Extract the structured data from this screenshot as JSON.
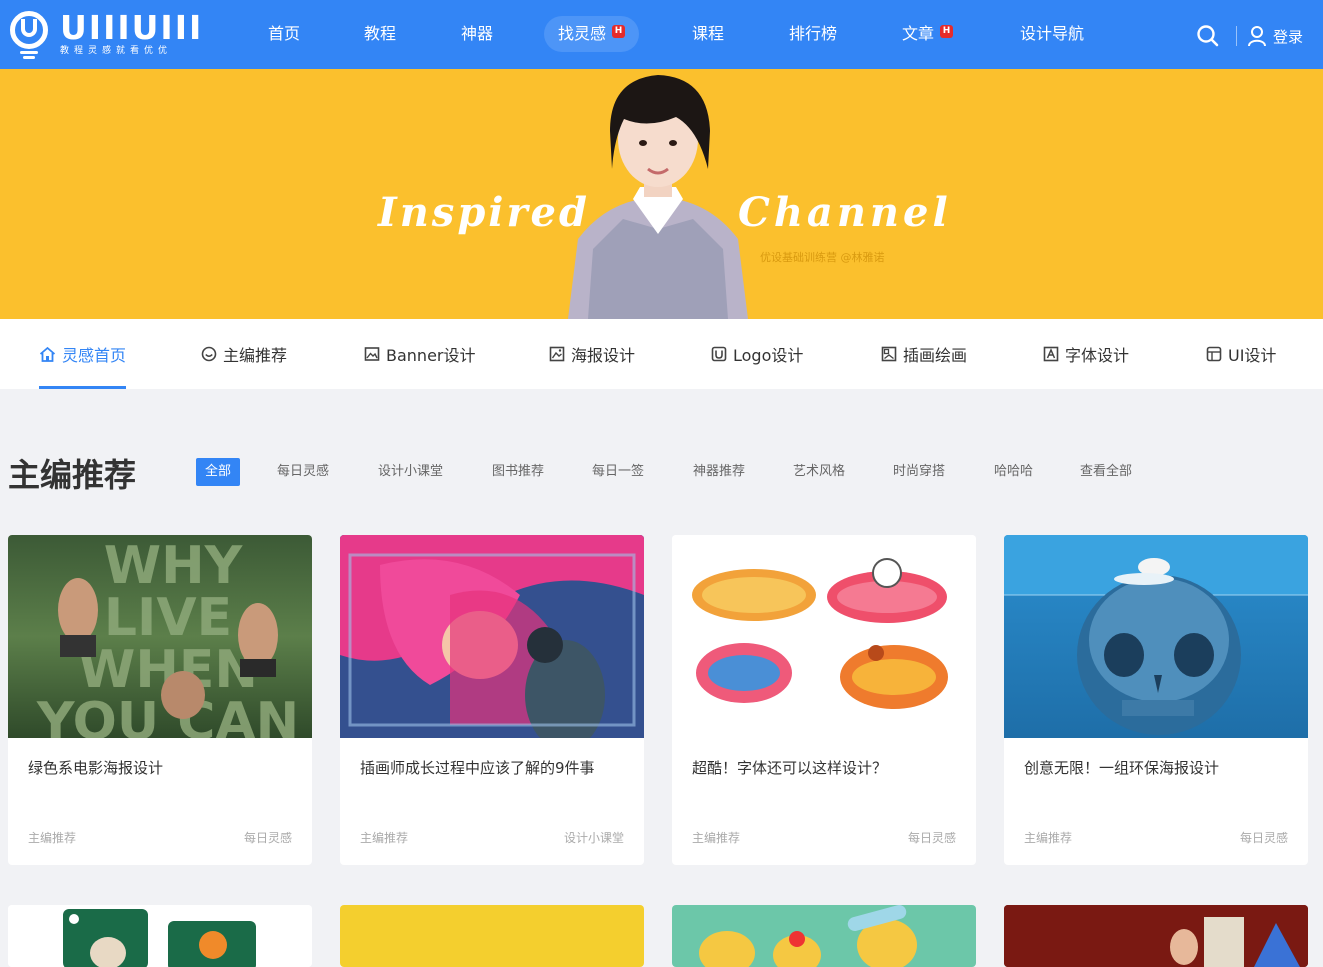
{
  "brand": {
    "name": "UIIIUIII",
    "slogan": "教程灵感就看优优"
  },
  "nav": {
    "items": [
      {
        "label": "首页",
        "hot": false,
        "active": false
      },
      {
        "label": "教程",
        "hot": false,
        "active": false
      },
      {
        "label": "神器",
        "hot": false,
        "active": false
      },
      {
        "label": "找灵感",
        "hot": true,
        "active": true
      },
      {
        "label": "课程",
        "hot": false,
        "active": false
      },
      {
        "label": "排行榜",
        "hot": false,
        "active": false
      },
      {
        "label": "文章",
        "hot": true,
        "active": false
      },
      {
        "label": "设计导航",
        "hot": false,
        "active": false
      }
    ],
    "hot_badge": "H",
    "login_label": "登录"
  },
  "banner": {
    "word_left": "Inspired",
    "word_right": "Channel",
    "credit": "优设基础训练营  @林雅诺"
  },
  "categories": [
    {
      "label": "灵感首页",
      "icon": "home-icon",
      "active": true
    },
    {
      "label": "主编推荐",
      "icon": "smile-icon",
      "active": false
    },
    {
      "label": "Banner设计",
      "icon": "image-icon",
      "active": false
    },
    {
      "label": "海报设计",
      "icon": "poster-icon",
      "active": false
    },
    {
      "label": "Logo设计",
      "icon": "logo-icon",
      "active": false
    },
    {
      "label": "插画绘画",
      "icon": "illustration-icon",
      "active": false
    },
    {
      "label": "字体设计",
      "icon": "font-icon",
      "active": false
    },
    {
      "label": "UI设计",
      "icon": "ui-icon",
      "active": false
    }
  ],
  "section": {
    "title": "主编推荐",
    "filters": [
      "全部",
      "每日灵感",
      "设计小课堂",
      "图书推荐",
      "每日一签",
      "神器推荐",
      "艺术风格",
      "时尚穿搭",
      "哈哈哈",
      "查看全部"
    ]
  },
  "cards": [
    {
      "title": "绿色系电影海报设计",
      "tag_left": "主编推荐",
      "tag_right": "每日灵感",
      "image_text": "WHY LIVE WHEN YOU CAN"
    },
    {
      "title": "插画师成长过程中应该了解的9件事",
      "tag_left": "主编推荐",
      "tag_right": "设计小课堂",
      "image_text": ""
    },
    {
      "title": "超酷！字体还可以这样设计？",
      "tag_left": "主编推荐",
      "tag_right": "每日灵感",
      "image_text": ""
    },
    {
      "title": "创意无限！一组环保海报设计",
      "tag_left": "主编推荐",
      "tag_right": "每日灵感",
      "image_text": ""
    }
  ],
  "colors": {
    "primary": "#3385f5",
    "banner": "#fbc02d",
    "hot": "#e52b2b"
  }
}
